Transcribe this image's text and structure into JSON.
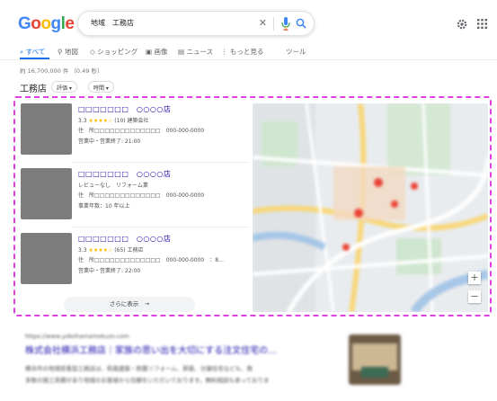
{
  "header": {
    "logo_parts": [
      "G",
      "o",
      "o",
      "g",
      "l",
      "e"
    ],
    "query": "地域　工務店"
  },
  "tabs": [
    {
      "label": "すべて",
      "active": true,
      "icon": "search-icon"
    },
    {
      "label": "地図",
      "active": false,
      "icon": "map-pin-icon"
    },
    {
      "label": "ショッピング",
      "active": false,
      "icon": "tag-icon"
    },
    {
      "label": "画像",
      "active": false,
      "icon": "image-icon"
    },
    {
      "label": "ニュース",
      "active": false,
      "icon": "news-icon"
    },
    {
      "label": "もっと見る",
      "active": false,
      "icon": "more-vert-icon"
    },
    {
      "label": "ツール",
      "active": false,
      "icon": ""
    }
  ],
  "results_count": "約 16,700,000 件 （0.49 秒）",
  "local": {
    "title": "工務店",
    "filters": [
      "評価 ▾",
      "時間 ▾"
    ],
    "businesses": [
      {
        "name": "□□□□□□□　○○○○店",
        "rating": "3.3",
        "stars": "★★★★☆",
        "reviews": "(10)",
        "category": "建築会社",
        "address": "住　所□□□□□□□□□□□□□　000-000-0000",
        "status": "営業中・営業終了: 21:00"
      },
      {
        "name": "□□□□□□□　○○○○店",
        "review_line": "レビューなし　リフォーム業",
        "address": "住　所□□□□□□□□□□□□□　000-000-0000",
        "years": "事業年数：10 年以上"
      },
      {
        "name": "□□□□□□□　○○○○店",
        "rating": "3.3",
        "stars": "★★★★☆",
        "reviews": "(65)",
        "category": "工務店",
        "address": "住　所□□□□□□□□□□□□□　000-000-0000　：8…",
        "status": "営業中・営業終了: 22:00"
      }
    ],
    "more_label": "さらに表示　→",
    "map_controls": {
      "zoom_in": "+",
      "zoom_out": "−"
    }
  },
  "organic": {
    "url": "https://www.yokohamamokuzo.com",
    "title": "株式会社横浜工務店｜家族の思い出を大切にする注文住宅の…",
    "snippet_1": "横浜市の地域密着型工務店は、和風建築・耐震リフォーム、新築、分譲住宅なども、数",
    "snippet_2": "多数の施工実績があり地域のお客様から信頼をいただいております。無料相談も承っておりま"
  },
  "colors": {
    "link": "#1a0dab",
    "accent": "#1a73e8",
    "highlight_border": "#e040e0",
    "star": "#fbbc04"
  }
}
